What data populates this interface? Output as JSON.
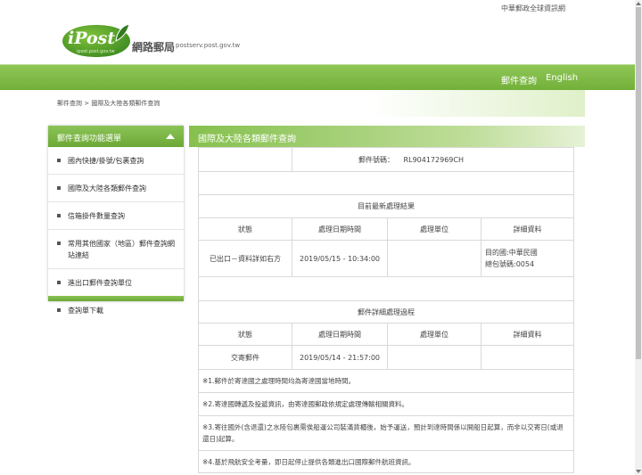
{
  "topbar": {
    "gov_link": "中華郵政全球資訊網"
  },
  "logo": {
    "word": "iPost",
    "sub": "ipost.post.gov.tw",
    "site_name": "網路郵局",
    "site_url": "postserv.post.gov.tw"
  },
  "nav": {
    "items": [
      "郵件查詢",
      "English"
    ]
  },
  "breadcrumb": "郵件查詢 > 國際及大陸各類郵件查詢",
  "sidebar": {
    "title": "郵件查詢功能選單",
    "items": [
      "國內快捷/掛號/包裹查詢",
      "國際及大陸各類郵件查詢",
      "信箱掛件數量查詢",
      "常用其他國家（地區）郵件查詢網站連結",
      "進出口郵件查詢單位",
      "查詢單下載"
    ]
  },
  "main": {
    "title": "國際及大陸各類郵件查詢",
    "tracking_label": "郵件號碼：",
    "tracking_number": "RL904172969CH",
    "latest_title": "目前最新處理結果",
    "cols": [
      "狀態",
      "處理日期時間",
      "處理單位",
      "詳細資料"
    ],
    "latest_row": {
      "status": "已出口－資料詳如右方",
      "datetime": "2019/05/15 - 10:34:00",
      "unit": "",
      "detail1": "目的國:中華民國",
      "detail2": "總包號碼:0054"
    },
    "detail_title": "郵件詳細處理過程",
    "detail_row": {
      "status": "交寄郵件",
      "datetime": "2019/05/14 - 21:57:00",
      "unit": "",
      "detail": ""
    },
    "notes": [
      "※1.郵件於寄達國之處理時間均為寄達國當地時間。",
      "※2.寄達國轉遞及投遞資訊，由寄達國郵政依規定處理傳輸相關資料。",
      "※3.寄往國外(含退還)之水陸包裹需俟船運公司裝滿貨櫃後，始予運送，預計到達時間係以開船日起算，而非以交寄日(或退還日)起算。",
      "※4.基於飛航安全考量，即日起停止提供各類進出口國際郵件航班資訊。"
    ]
  },
  "colors": {
    "brand_green": "#78b43f",
    "header_green": "#8cc457"
  }
}
